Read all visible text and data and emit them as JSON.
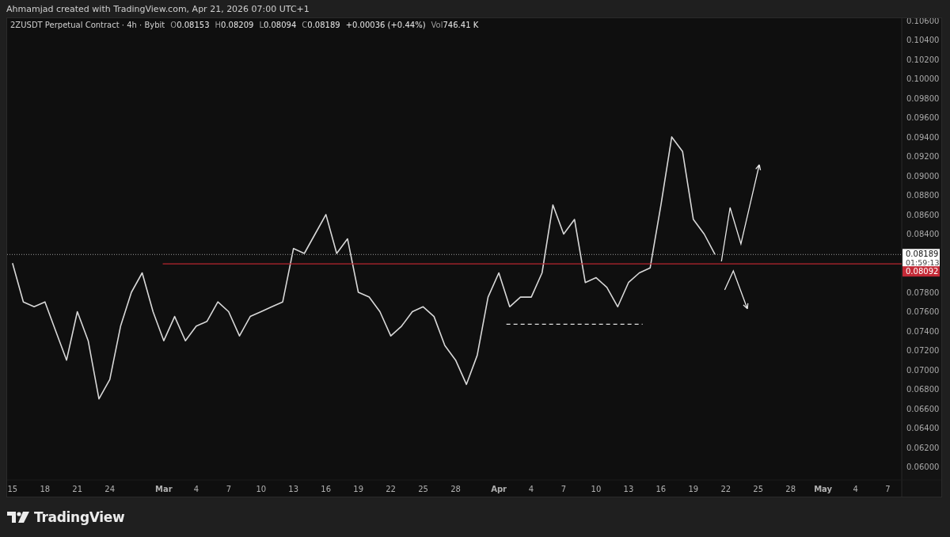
{
  "header": {
    "text": "Ahmamjad created with TradingView.com, Apr 21, 2026 07:00 UTC+1"
  },
  "legend": {
    "symbol": "2ZUSDT Perpetual Contract · 4h · Bybit",
    "ohlc": [
      {
        "label": "O",
        "value": "0.08153"
      },
      {
        "label": "H",
        "value": "0.08209"
      },
      {
        "label": "L",
        "value": "0.08094"
      },
      {
        "label": "C",
        "value": "0.08189"
      }
    ],
    "change": "+0.00036 (+0.44%)",
    "volume": {
      "label": "Vol",
      "value": "746.41 K"
    }
  },
  "chart": {
    "chart_data": {
      "type": "line",
      "categories": [
        "15",
        null,
        null,
        "18",
        null,
        null,
        "21",
        null,
        null,
        "24",
        null,
        null,
        null,
        null,
        "Mar",
        null,
        null,
        "4",
        null,
        null,
        "7",
        null,
        null,
        "10",
        null,
        null,
        "13",
        null,
        null,
        "16",
        null,
        null,
        "19",
        null,
        null,
        "22",
        null,
        null,
        "25",
        null,
        null,
        "28",
        null,
        null,
        null,
        "Apr",
        null,
        null,
        "4",
        null,
        null,
        "7",
        null,
        null,
        "10",
        null,
        null,
        "13",
        null,
        null,
        "16",
        null,
        null,
        "19",
        null,
        null,
        "22",
        null,
        null,
        "25",
        null,
        null,
        "28",
        null,
        null,
        "May",
        null,
        null,
        "4",
        null,
        null,
        "7"
      ],
      "series": [
        {
          "color": "#d8d8d8",
          "values": [
            0.081,
            0.077,
            0.0765,
            0.077,
            0.074,
            0.071,
            0.076,
            0.073,
            0.067,
            0.069,
            0.0745,
            0.078,
            0.08,
            0.076,
            0.073,
            0.0755,
            0.073,
            0.0745,
            0.075,
            0.077,
            0.076,
            0.0735,
            0.0755,
            0.076,
            0.0765,
            0.077,
            0.0825,
            0.082,
            0.084,
            0.086,
            0.082,
            0.0835,
            0.078,
            0.0775,
            0.076,
            0.0735,
            0.0745,
            0.076,
            0.0765,
            0.0755,
            0.0725,
            0.071,
            0.0685,
            0.0715,
            0.0775,
            0.08,
            0.0765,
            0.0775,
            0.0775,
            0.08,
            0.087,
            0.084,
            0.0855,
            0.079,
            0.0795,
            0.0785,
            0.0765,
            0.079,
            0.08,
            0.0805,
            0.087,
            0.094,
            0.0925,
            0.0855,
            0.084,
            0.0819,
            null,
            null,
            null,
            null,
            null,
            null,
            null,
            null,
            null,
            null,
            null,
            null,
            null,
            null,
            null,
            null
          ]
        }
      ],
      "ylim": [
        0.05865,
        0.10624
      ],
      "yticks": [
        {
          "value": 0.106,
          "label": "0.10600"
        },
        {
          "value": 0.104,
          "label": "0.10400"
        },
        {
          "value": 0.102,
          "label": "0.10200"
        },
        {
          "value": 0.1,
          "label": "0.10000"
        },
        {
          "value": 0.098,
          "label": "0.09800"
        },
        {
          "value": 0.096,
          "label": "0.09600"
        },
        {
          "value": 0.094,
          "label": "0.09400"
        },
        {
          "value": 0.092,
          "label": "0.09200"
        },
        {
          "value": 0.09,
          "label": "0.09000"
        },
        {
          "value": 0.088,
          "label": "0.08800"
        },
        {
          "value": 0.086,
          "label": "0.08600"
        },
        {
          "value": 0.084,
          "label": "0.08400"
        },
        {
          "value": 0.078,
          "label": "0.07800"
        },
        {
          "value": 0.076,
          "label": "0.07600"
        },
        {
          "value": 0.074,
          "label": "0.07400"
        },
        {
          "value": 0.072,
          "label": "0.07200"
        },
        {
          "value": 0.07,
          "label": "0.07000"
        },
        {
          "value": 0.068,
          "label": "0.06800"
        },
        {
          "value": 0.066,
          "label": "0.06600"
        },
        {
          "value": 0.064,
          "label": "0.06400"
        },
        {
          "value": 0.062,
          "label": "0.06200"
        },
        {
          "value": 0.06,
          "label": "0.06000"
        }
      ]
    },
    "price_tags": [
      {
        "kind": "current",
        "price": "0.08189",
        "countdown": "01:59:13"
      },
      {
        "kind": "level",
        "price": "0.08092",
        "color": "#c42a37"
      }
    ]
  },
  "footer": {
    "brand": "TradingView"
  }
}
